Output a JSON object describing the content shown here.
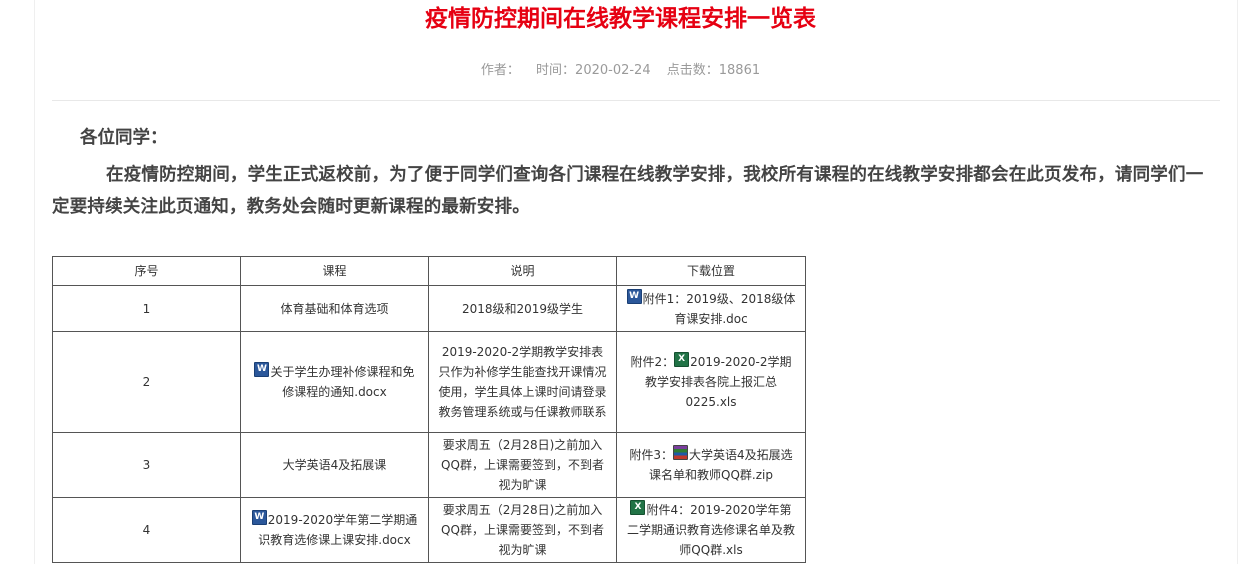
{
  "article": {
    "title": "疫情防控期间在线教学课程安排一览表",
    "meta": {
      "author_label": "作者：",
      "time_label": "时间：2020-02-24",
      "clicks_label": "点击数：18861"
    },
    "greeting": "各位同学：",
    "paragraph": "在疫情防控期间，学生正式返校前，为了便于同学们查询各门课程在线教学安排，我校所有课程的在线教学安排都会在此页发布，请同学们一定要持续关注此页通知，教务处会随时更新课程的最新安排。"
  },
  "table": {
    "headers": [
      "序号",
      "课程",
      "说明",
      "下载位置"
    ],
    "rows": [
      {
        "no": "1",
        "course": "体育基础和体育选项",
        "course_icon": "",
        "note": "2018级和2019级学生",
        "dl_prefix": "",
        "dl_icon": "word-icon",
        "dl_text": "附件1：2019级、2018级体育课安排.doc"
      },
      {
        "no": "2",
        "course": "关于学生办理补修课程和免修课程的通知.docx",
        "course_icon": "word-icon",
        "note": "2019-2020-2学期教学安排表只作为补修学生能查找开课情况使用，学生具体上课时间请登录教务管理系统或与任课教师联系",
        "dl_prefix": "附件2：",
        "dl_icon": "excel-icon",
        "dl_text": "2019-2020-2学期教学安排表各院上报汇总0225.xls"
      },
      {
        "no": "3",
        "course": "大学英语4及拓展课",
        "course_icon": "",
        "note": "要求周五（2月28日)之前加入QQ群，上课需要签到，不到者视为旷课",
        "dl_prefix": "附件3：",
        "dl_icon": "archive-icon",
        "dl_text": "大学英语4及拓展选课名单和教师QQ群.zip"
      },
      {
        "no": "4",
        "course": "2019-2020学年第二学期通识教育选修课上课安排.docx",
        "course_icon": "word-icon",
        "note": "要求周五（2月28日)之前加入QQ群，上课需要签到，不到者视为旷课",
        "dl_prefix": "",
        "dl_icon": "excel-icon",
        "dl_text": "附件4：2019-2020学年第二学期通识教育选修课名单及教师QQ群.xls"
      }
    ]
  },
  "colors": {
    "title": "#e60012",
    "meta_text": "#9a9a9a",
    "body_text": "#444444",
    "table_border": "#555555"
  }
}
